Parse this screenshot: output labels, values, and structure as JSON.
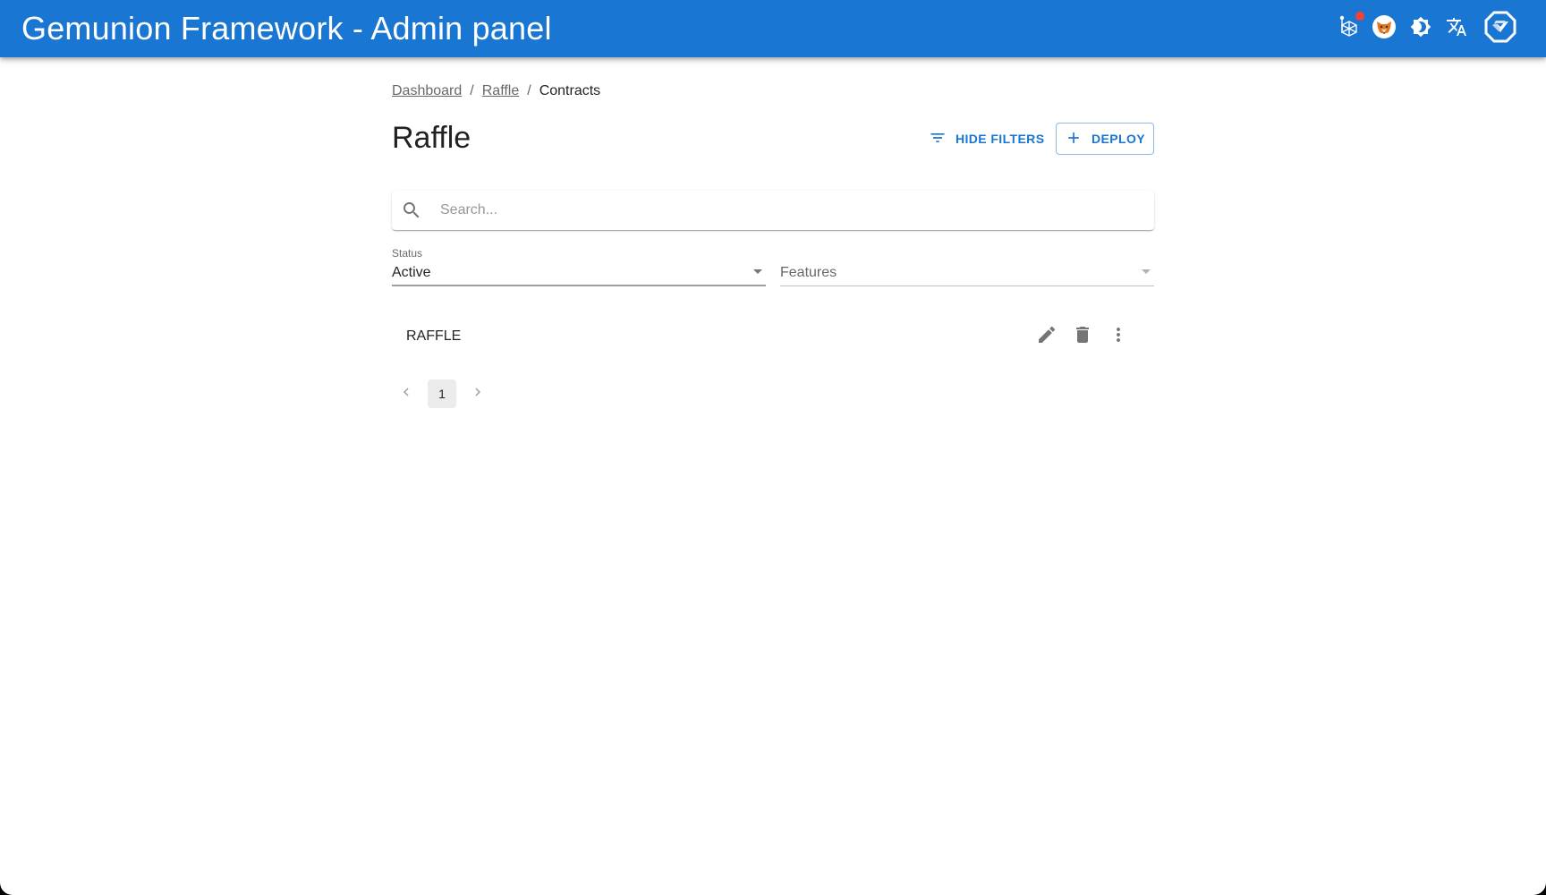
{
  "app": {
    "title": "Gemunion Framework - Admin panel",
    "brand_color": "#1976d2",
    "toolbar_icons": [
      {
        "name": "network-icon",
        "has_notification_dot": true
      },
      {
        "name": "metamask-fox-icon"
      },
      {
        "name": "theme-toggle-icon"
      },
      {
        "name": "translate-icon"
      },
      {
        "name": "gemunion-logo-icon"
      }
    ]
  },
  "breadcrumb": {
    "items": [
      {
        "label": "Dashboard",
        "link": true
      },
      {
        "label": "Raffle",
        "link": true
      },
      {
        "label": "Contracts",
        "link": false
      }
    ],
    "separator": "/"
  },
  "page": {
    "title": "Raffle",
    "hide_filters_label": "HIDE FILTERS",
    "deploy_label": "DEPLOY"
  },
  "search": {
    "value": "",
    "placeholder": "Search..."
  },
  "filters": {
    "status": {
      "label": "Status",
      "value": "Active"
    },
    "features": {
      "label": "",
      "placeholder": "Features",
      "value": ""
    }
  },
  "list": {
    "items": [
      {
        "title": "RAFFLE",
        "actions": [
          "edit",
          "delete",
          "more"
        ]
      }
    ]
  },
  "pagination": {
    "current_page": "1",
    "pages": [
      "1"
    ]
  }
}
